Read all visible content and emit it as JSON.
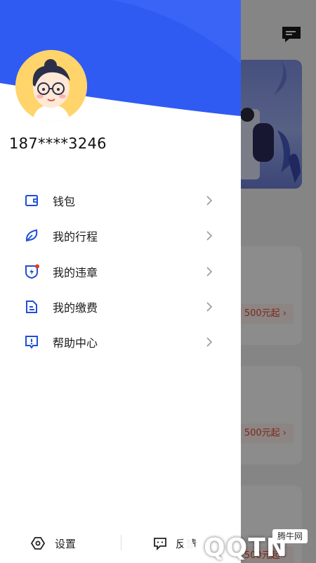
{
  "user": {
    "phone": "187****3246"
  },
  "menu": {
    "items": [
      {
        "label": "钱包",
        "icon": "wallet-icon"
      },
      {
        "label": "我的行程",
        "icon": "leaf-icon"
      },
      {
        "label": "我的违章",
        "icon": "violation-shield-icon"
      },
      {
        "label": "我的缴费",
        "icon": "payment-doc-icon"
      },
      {
        "label": "帮助中心",
        "icon": "help-alert-icon"
      }
    ]
  },
  "bottom": {
    "settings_label": "设置",
    "feedback_label": "反馈"
  },
  "background": {
    "cards": [
      {
        "price": "500元起 ›"
      },
      {
        "price": "500元起 ›"
      },
      {
        "price": "500元起 ›"
      }
    ]
  },
  "watermark": {
    "brand": "QQTN",
    "tag": "腾牛网"
  },
  "colors": {
    "brand_blue": "#2f5bf3",
    "icon_blue": "#1f4fd6",
    "badge_red": "#e9372a"
  }
}
